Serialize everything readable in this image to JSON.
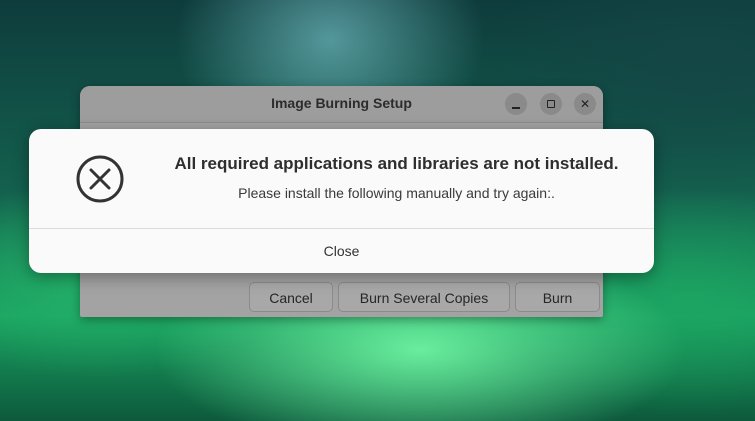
{
  "background_window": {
    "title": "Image Burning Setup",
    "buttons": {
      "cancel": "Cancel",
      "burn_several_copies": "Burn Several Copies",
      "burn": "Burn"
    }
  },
  "dialog": {
    "icon": "error-circle-x-icon",
    "heading": "All required applications and libraries are not installed.",
    "message": "Please install the following manually and try again:.",
    "close_label": "Close"
  },
  "colors": {
    "dialog_background": "#fafafa",
    "dim_window": "#a3a3a3",
    "text_primary": "#2e2e2e"
  }
}
